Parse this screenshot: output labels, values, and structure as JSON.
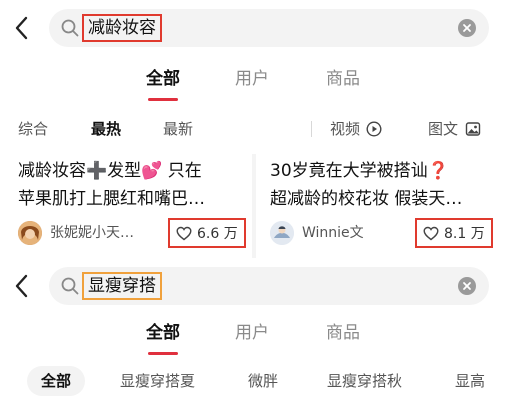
{
  "colors": {
    "accent": "#e0303e",
    "highlight_red": "#e03a2e",
    "highlight_orange": "#f0a13c"
  },
  "top": {
    "back_icon": "chevron-left-icon",
    "search": {
      "query": "减龄妆容",
      "icon": "search-icon",
      "clear_icon": "clear-circle-icon"
    },
    "tabs": [
      {
        "label": "全部",
        "active": true
      },
      {
        "label": "用户"
      },
      {
        "label": "商品"
      }
    ],
    "filters": {
      "comprehensive": "综合",
      "hottest": "最热",
      "newest": "最新",
      "video": "视频",
      "image_text": "图文",
      "video_icon": "play-circle-icon",
      "image_icon": "image-icon"
    },
    "cards": [
      {
        "title_line1": "减龄妆容➕发型💕 只在",
        "title_line2": "苹果肌打上腮红和嘴巴…",
        "author": "张妮妮小天…",
        "likes": "6.6 万"
      },
      {
        "title_line1": "30岁竟在大学被搭讪❓",
        "title_line2": "超减龄的校花妆 假装天…",
        "author": "Winnie文",
        "likes": "8.1 万"
      }
    ]
  },
  "bottom": {
    "search": {
      "query": "显瘦穿搭"
    },
    "tabs": [
      {
        "label": "全部",
        "active": true
      },
      {
        "label": "用户"
      },
      {
        "label": "商品"
      }
    ],
    "chips": [
      "全部",
      "显瘦穿搭夏",
      "微胖",
      "显瘦穿搭秋",
      "显高"
    ]
  }
}
